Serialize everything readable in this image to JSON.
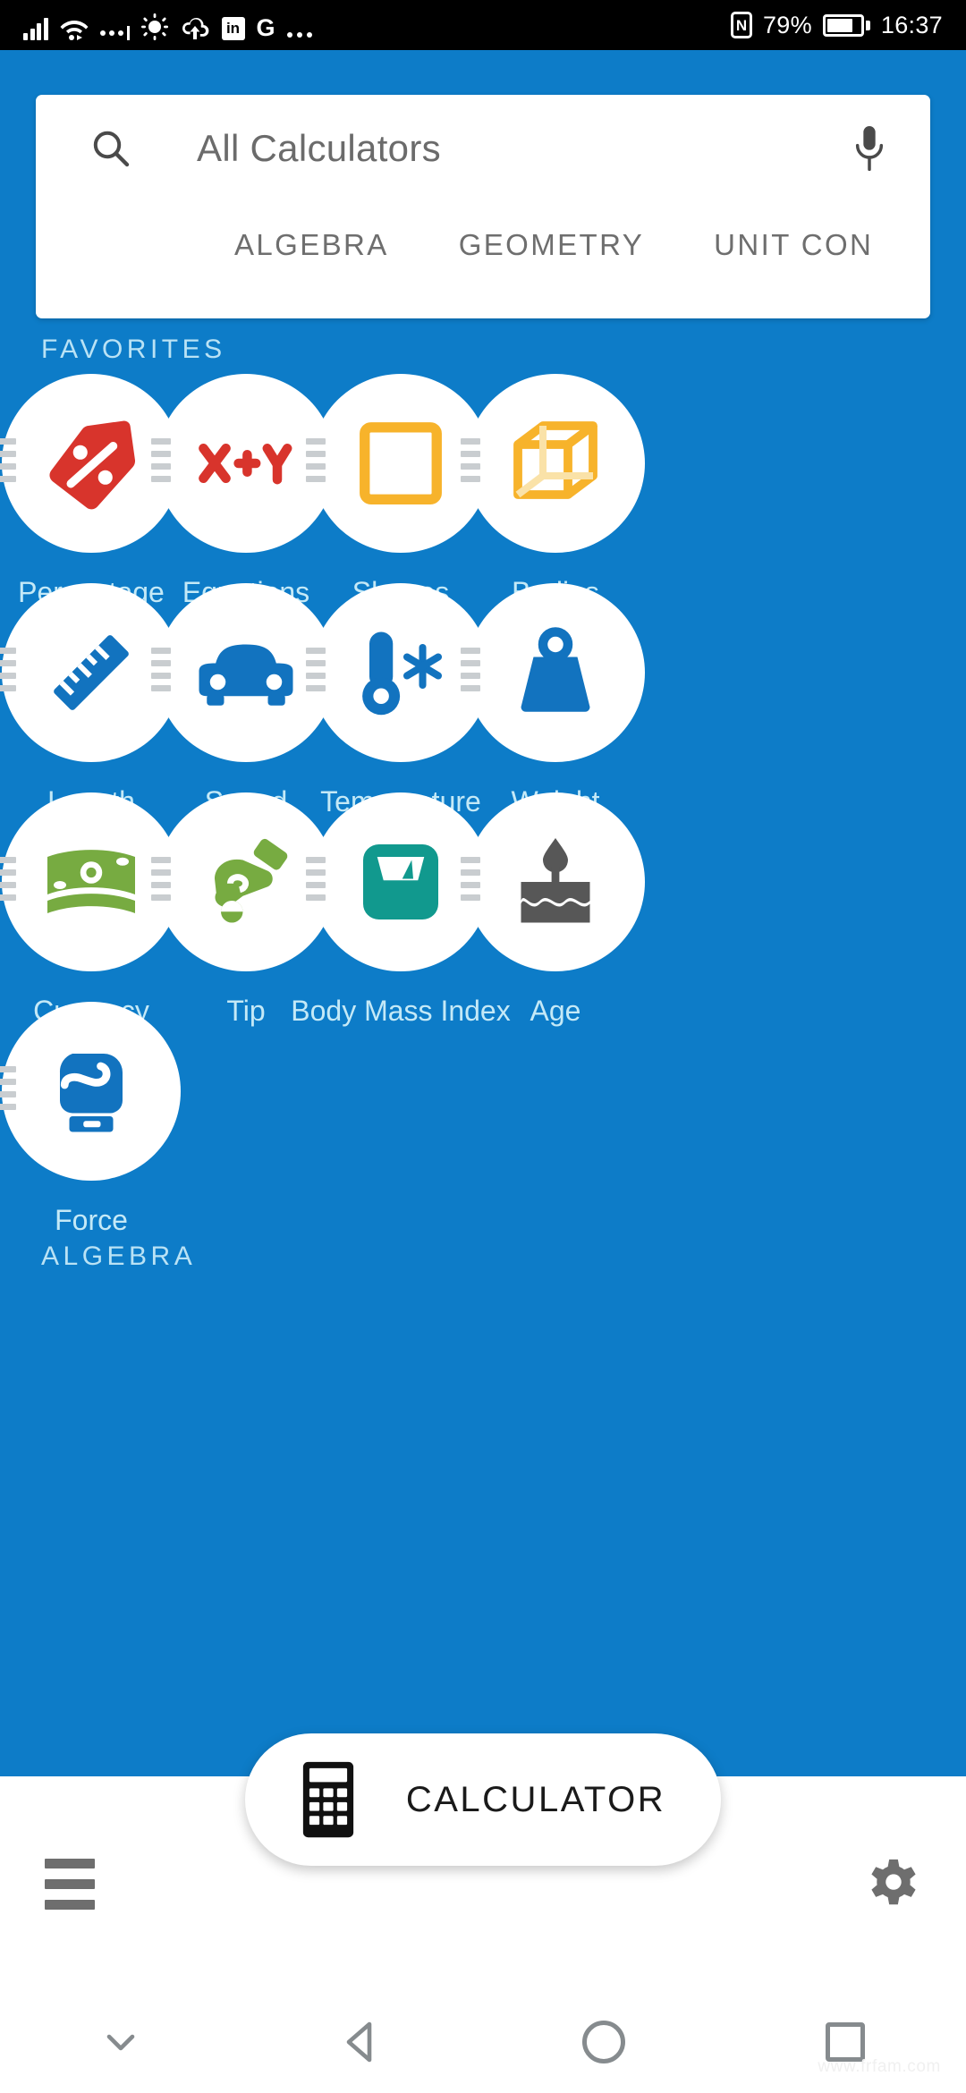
{
  "status_bar": {
    "nfc_label": "N",
    "battery_percent": "79%",
    "time": "16:37",
    "linkedin_label": "in",
    "google_label": "G",
    "icons": [
      "signal-icon",
      "wifi-icon",
      "mobile-data-icon",
      "brightness-icon",
      "cloud-upload-icon",
      "linkedin-icon",
      "google-icon",
      "more-icon"
    ]
  },
  "search": {
    "title": "All Calculators",
    "search_icon": "search-icon",
    "mic_icon": "microphone-icon",
    "tabs": [
      {
        "label": "ALGEBRA"
      },
      {
        "label": "GEOMETRY"
      },
      {
        "label": "UNIT CON"
      }
    ]
  },
  "sections": {
    "favorites": "FAVORITES",
    "algebra": "ALGEBRA"
  },
  "favorites": [
    {
      "label": "Percentage",
      "icon": "price-tag-percent-icon",
      "color": "#d8342c"
    },
    {
      "label": "Equations",
      "icon": "x-plus-y-icon",
      "color": "#d8342c"
    },
    {
      "label": "Shapes",
      "icon": "square-outline-icon",
      "color": "#f7b32b"
    },
    {
      "label": "Bodies",
      "icon": "cube-outline-icon",
      "color": "#f7b32b"
    },
    {
      "label": "Length",
      "icon": "ruler-icon",
      "color": "#1273bf"
    },
    {
      "label": "Speed",
      "icon": "car-icon",
      "color": "#1273bf"
    },
    {
      "label": "Temperature",
      "icon": "thermometer-snow-icon",
      "color": "#1273bf"
    },
    {
      "label": "Weight",
      "icon": "weight-icon",
      "color": "#1273bf"
    },
    {
      "label": "Currency\nConverter",
      "icon": "banknote-icon",
      "color": "#77ab41"
    },
    {
      "label": "Tip",
      "icon": "hand-coin-icon",
      "color": "#77ab41"
    },
    {
      "label": "Body Mass\nIndex",
      "icon": "bathroom-scale-icon",
      "color": "#11998e"
    },
    {
      "label": "Age",
      "icon": "birthday-cake-icon",
      "color": "#575757"
    },
    {
      "label": "Force",
      "icon": "boxing-glove-icon",
      "color": "#1273bf"
    }
  ],
  "fab": {
    "label": "CALCULATOR",
    "icon": "calculator-icon"
  },
  "bottom_bar": {
    "menu_icon": "hamburger-menu-icon",
    "settings_icon": "gear-icon"
  },
  "nav_bar": {
    "hide_icon": "chevron-down-icon",
    "back_icon": "back-triangle-icon",
    "home_icon": "home-circle-icon",
    "recents_icon": "recents-square-icon"
  },
  "watermark": "www.frfam.com",
  "colors": {
    "app_background": "#0d7cc8",
    "card_background": "#ffffff",
    "label_text": "#c4e9f7",
    "section_header": "#b9e2f5",
    "status_bar": "#000000"
  }
}
